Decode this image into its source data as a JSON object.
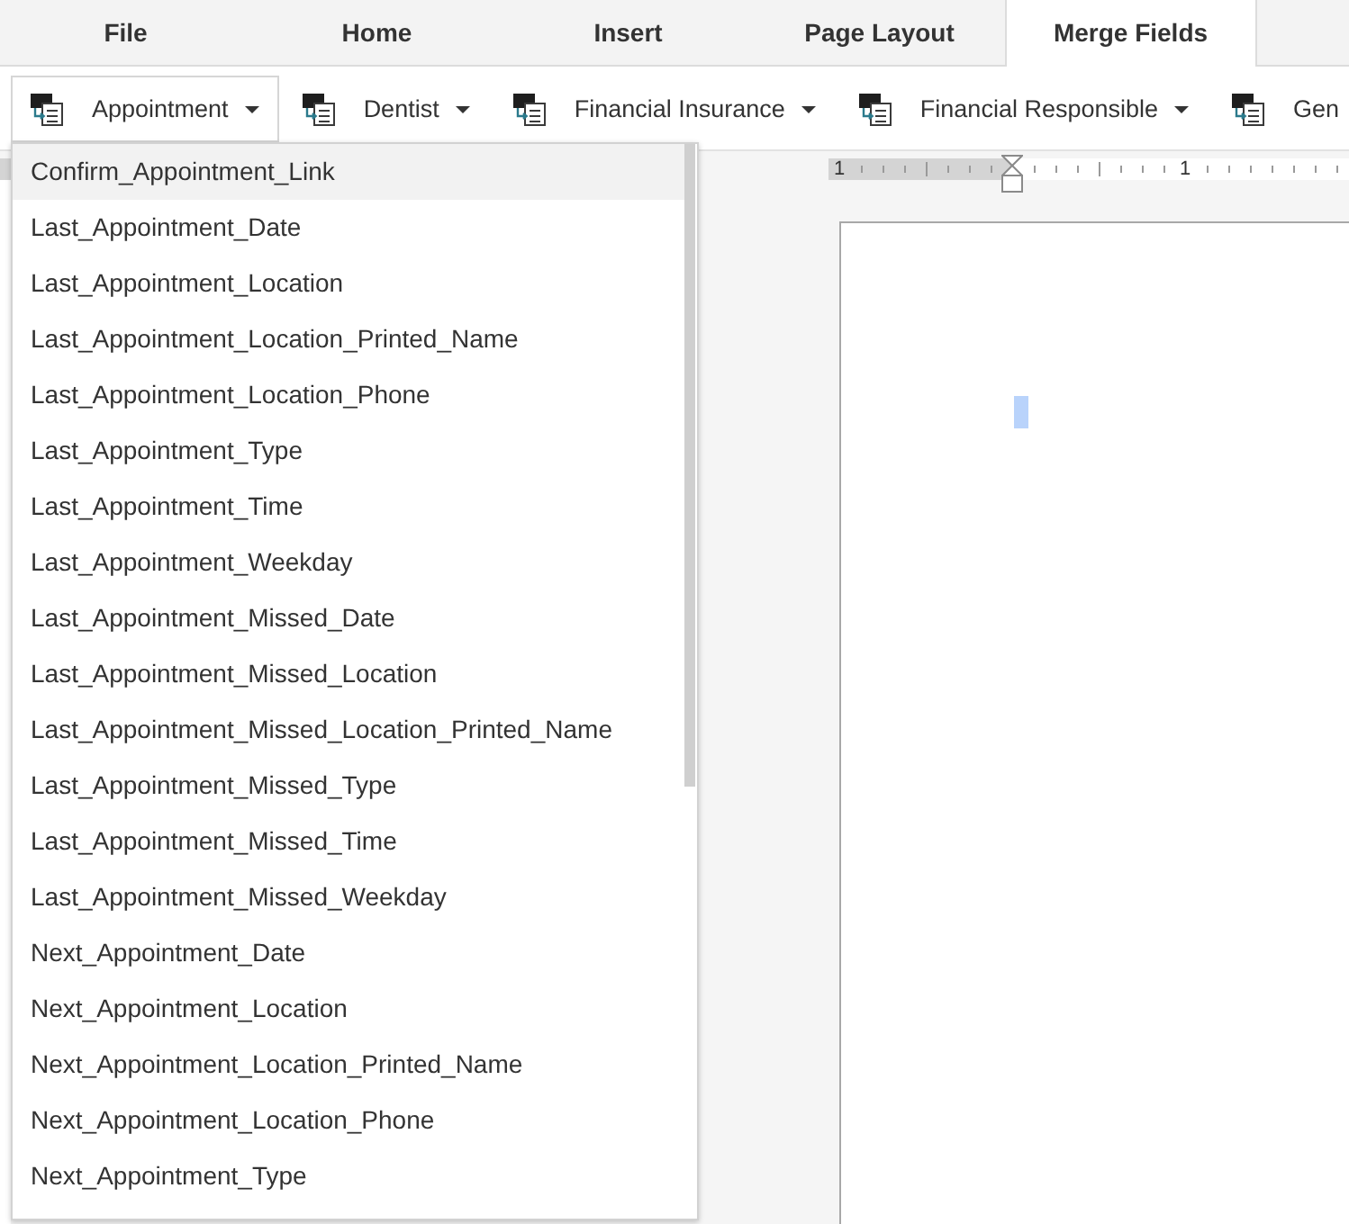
{
  "tabs": [
    {
      "label": "File",
      "selected": false
    },
    {
      "label": "Home",
      "selected": false
    },
    {
      "label": "Insert",
      "selected": false
    },
    {
      "label": "Page Layout",
      "selected": false
    },
    {
      "label": "Merge Fields",
      "selected": true
    }
  ],
  "toolbar": [
    {
      "label": "Appointment",
      "dropdown": true,
      "expanded": true
    },
    {
      "label": "Dentist",
      "dropdown": true,
      "expanded": false
    },
    {
      "label": "Financial Insurance",
      "dropdown": true,
      "expanded": false
    },
    {
      "label": "Financial Responsible",
      "dropdown": true,
      "expanded": false
    },
    {
      "label": "Gen",
      "dropdown": false,
      "expanded": false
    }
  ],
  "menu": {
    "items": [
      {
        "label": "Confirm_Appointment_Link",
        "selected": true
      },
      {
        "label": "Last_Appointment_Date",
        "selected": false
      },
      {
        "label": "Last_Appointment_Location",
        "selected": false
      },
      {
        "label": "Last_Appointment_Location_Printed_Name",
        "selected": false
      },
      {
        "label": "Last_Appointment_Location_Phone",
        "selected": false
      },
      {
        "label": "Last_Appointment_Type",
        "selected": false
      },
      {
        "label": "Last_Appointment_Time",
        "selected": false
      },
      {
        "label": "Last_Appointment_Weekday",
        "selected": false
      },
      {
        "label": "Last_Appointment_Missed_Date",
        "selected": false
      },
      {
        "label": "Last_Appointment_Missed_Location",
        "selected": false
      },
      {
        "label": "Last_Appointment_Missed_Location_Printed_Name",
        "selected": false
      },
      {
        "label": "Last_Appointment_Missed_Type",
        "selected": false
      },
      {
        "label": "Last_Appointment_Missed_Time",
        "selected": false
      },
      {
        "label": "Last_Appointment_Missed_Weekday",
        "selected": false
      },
      {
        "label": "Next_Appointment_Date",
        "selected": false
      },
      {
        "label": "Next_Appointment_Location",
        "selected": false
      },
      {
        "label": "Next_Appointment_Location_Printed_Name",
        "selected": false
      },
      {
        "label": "Next_Appointment_Location_Phone",
        "selected": false
      },
      {
        "label": "Next_Appointment_Type",
        "selected": false
      }
    ]
  },
  "ruler": {
    "labels": [
      "1",
      "1"
    ]
  }
}
